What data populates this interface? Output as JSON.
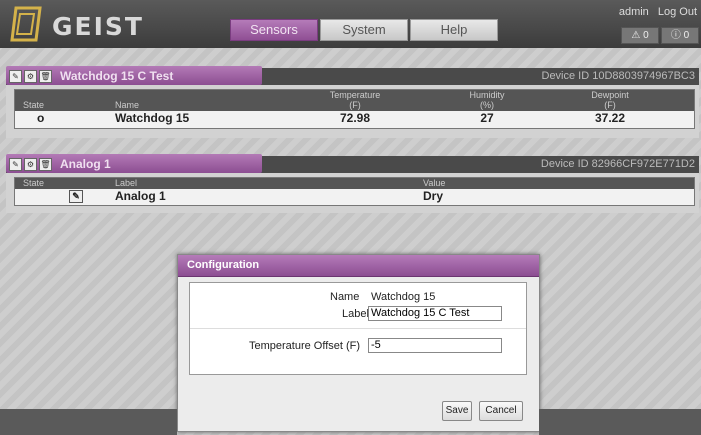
{
  "header": {
    "logo_text": "GEIST",
    "tabs": [
      {
        "label": "Sensors",
        "active": true
      },
      {
        "label": "System",
        "active": false
      },
      {
        "label": "Help",
        "active": false
      }
    ],
    "user": "admin",
    "logout": "Log Out",
    "alerts": [
      {
        "icon": "warning-icon",
        "count": "0"
      },
      {
        "icon": "info-icon",
        "count": "0"
      }
    ],
    "accent": "#9b5ba0"
  },
  "panels": [
    {
      "title": "Watchdog 15 C Test",
      "device_id": "Device ID 10D8803974967BC3",
      "columns": [
        "State",
        "Name",
        "Temperature\n(F)",
        "Humidity\n(%)",
        "Dewpoint\n(F)"
      ],
      "row": {
        "state": "o",
        "name": "Watchdog 15",
        "temperature": "72.98",
        "humidity": "27",
        "dewpoint": "37.22"
      }
    },
    {
      "title": "Analog 1",
      "device_id": "Device ID 82966CF972E771D2",
      "columns": [
        "State",
        "Label",
        "Value"
      ],
      "row": {
        "label": "Analog 1",
        "value": "Dry"
      }
    }
  ],
  "modal": {
    "title": "Configuration",
    "name_label": "Name",
    "name_value": "Watchdog 15",
    "label_label": "Label",
    "label_value": "Watchdog 15 C Test",
    "offset_label": "Temperature Offset (F)",
    "offset_value": "-5",
    "save": "Save",
    "cancel": "Cancel"
  }
}
